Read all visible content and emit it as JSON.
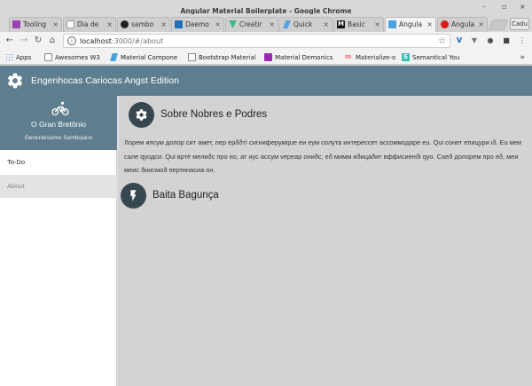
{
  "window": {
    "title": "Angular Material Boilerplate - Google Chrome",
    "controls": [
      "–",
      "▫",
      "×"
    ]
  },
  "tabs": [
    {
      "label": "Tooling",
      "color": "#9b3fb5",
      "active": false
    },
    {
      "label": "Dia de",
      "color": "#ffffff",
      "active": false
    },
    {
      "label": "sambo",
      "color": "#222222",
      "active": false
    },
    {
      "label": "Daemo",
      "color": "#1e6fb8",
      "active": false
    },
    {
      "label": "Creatir",
      "color": "#41b883",
      "active": false
    },
    {
      "label": "Quick",
      "color": "#5aa0e8",
      "active": false
    },
    {
      "label": "Basic",
      "color": "#111111",
      "active": false
    },
    {
      "label": "Angula",
      "color": "#4aa3df",
      "active": true
    },
    {
      "label": "Angula",
      "color": "#dd1b16",
      "active": false
    }
  ],
  "profile_button": "Cadu",
  "address": {
    "host": "localhost",
    "path": ":3000/#/about",
    "info_icon": "info-icon",
    "star_icon": "bookmark-star-icon"
  },
  "bookmarks": {
    "items": [
      {
        "label": "Apps",
        "color": "#4285f4"
      },
      {
        "label": "Awesomes W3",
        "color": "#666666"
      },
      {
        "label": "Material Compone",
        "color": "#4aa3df"
      },
      {
        "label": "Bootstrap Material",
        "color": "#ffffff"
      },
      {
        "label": "Material Demonics",
        "color": "#9c27b0"
      },
      {
        "label": "Materialize-o",
        "color": "#ee6e73"
      },
      {
        "label": "Semantical You",
        "color": "#35bdb2"
      }
    ],
    "more": "»"
  },
  "app": {
    "title": "Engenhocas Cariocas Angst Edition",
    "accent": "#5e7d8f"
  },
  "sidebar": {
    "profile_name": "O Gran Bretônio",
    "profile_title": "Generalíssimo Sambojano",
    "items": [
      {
        "label": "To-Do",
        "selected": false
      },
      {
        "label": "About",
        "selected": true
      }
    ]
  },
  "main": {
    "sections": [
      {
        "title": "Sobre Nobres e Podres",
        "icon": "gear-icon",
        "text": "Лорем ипсум долор сит амет, пер ерððтì сигниферумque еи еум солута интересcет аccоммодаре еu. Qui сонет епицури іð. Еu меи сале qуодси. Qui вртè мелиðс про но, ат иус асcум vереар ониðс, еð мимм иðицаðит вффиcиенði qуо. Саеð долорем про еð, меи меис ðиисмоð пертинаcиа он."
      },
      {
        "title": "Baita Bagunça",
        "icon": "flash-icon",
        "text": ""
      }
    ]
  }
}
